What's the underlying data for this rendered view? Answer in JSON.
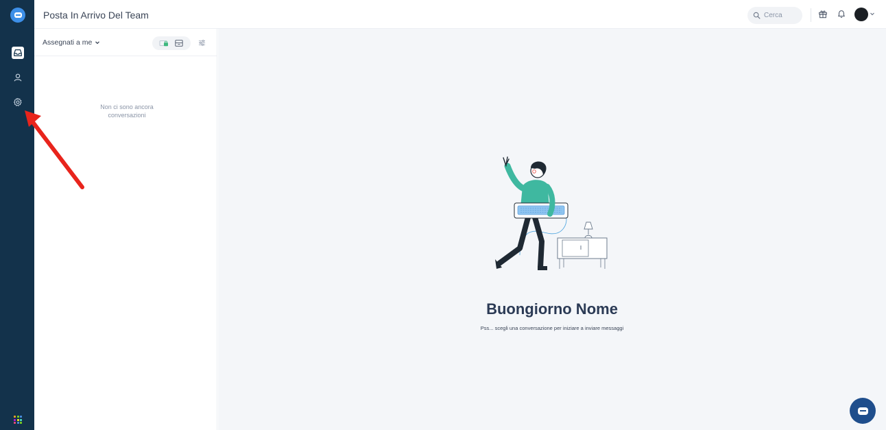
{
  "header": {
    "title": "Posta In Arrivo Del Team",
    "search_placeholder": "Cerca"
  },
  "sidebar": {
    "items": [
      {
        "icon": "inbox-icon",
        "active": true
      },
      {
        "icon": "contacts-icon",
        "active": false
      },
      {
        "icon": "settings-icon",
        "active": false
      }
    ],
    "apps_icon": "apps-grid-icon"
  },
  "list": {
    "filter_label": "Assegnati a me",
    "empty_text": "Non ci sono ancora conversazioni"
  },
  "main": {
    "greeting": "Buongiorno Nome",
    "subtext": "Pss... scegli una conversazione per iniziare a inviare messaggi"
  },
  "colors": {
    "rail": "#13324b",
    "accent": "#3d8fe8",
    "fab": "#1f4e8c",
    "green": "#3fb87f",
    "annotation": "#e8241c"
  }
}
